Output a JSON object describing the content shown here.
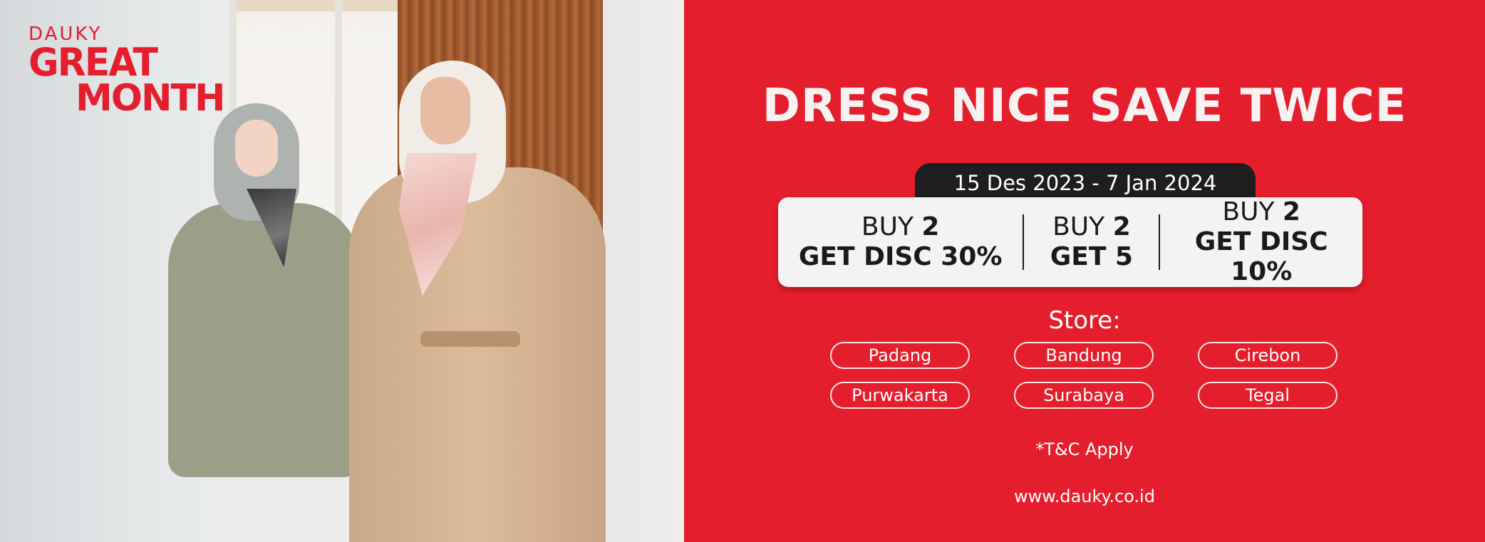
{
  "logo": {
    "brand": "DAUKY",
    "line1": "GREAT",
    "line2": "MONTH"
  },
  "promo": {
    "headline": "DRESS NICE SAVE TWICE",
    "date_range": "15 Des 2023 - 7 Jan 2024",
    "offers": [
      {
        "buy_prefix": "BUY ",
        "buy_qty": "2",
        "benefit": "GET DISC 30%"
      },
      {
        "buy_prefix": "BUY ",
        "buy_qty": "2",
        "benefit": "GET 5"
      },
      {
        "buy_prefix": "BUY ",
        "buy_qty": "2",
        "benefit": "GET DISC 10%"
      }
    ],
    "store_label": "Store:",
    "stores": [
      "Padang",
      "Bandung",
      "Cirebon",
      "Purwakarta",
      "Surabaya",
      "Tegal"
    ],
    "terms": "*T&C Apply",
    "website": "www.dauky.co.id"
  },
  "colors": {
    "brand_red": "#e41e2d",
    "date_pill": "#1f1e1f",
    "offer_box": "#f3f3f3"
  }
}
